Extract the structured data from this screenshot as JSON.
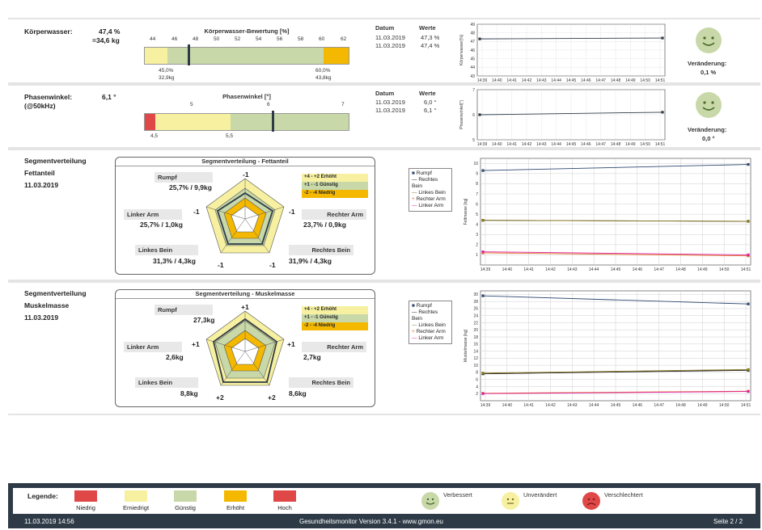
{
  "water": {
    "label": "Körperwasser:",
    "percent": "47,4 %",
    "kg": "=34,6 kg",
    "scale_title": "Körperwasser-Bewertung [%]",
    "ticks": [
      "44",
      "46",
      "48",
      "50",
      "52",
      "54",
      "56",
      "58",
      "60",
      "62"
    ],
    "low_pct": "45,0%",
    "low_kg": "32,9kg",
    "high_pct": "60,0%",
    "high_kg": "43,8kg",
    "col_date": "Datum",
    "col_values": "Werte",
    "rows": [
      {
        "date": "11.03.2019",
        "value": "47,3 %"
      },
      {
        "date": "11.03.2019",
        "value": "47,4 %"
      }
    ],
    "marker": 47.4,
    "change_label": "Veränderung:",
    "change_value": "0,1 %",
    "axis_label": "Körperwasser[%]",
    "yticks": [
      "49",
      "48",
      "47",
      "46",
      "45",
      "44",
      "43"
    ],
    "xticks": [
      "14:39",
      "14:40",
      "14:41",
      "14:42",
      "14:43",
      "14:44",
      "14:45",
      "14:46",
      "14:47",
      "14:48",
      "14:49",
      "14:50",
      "14:51"
    ]
  },
  "phase": {
    "label": "Phasenwinkel:",
    "label2": "(@50kHz)",
    "value": "6,1 °",
    "scale_title": "Phasenwinkel [°]",
    "ticks_top": [
      "5",
      "6",
      "7"
    ],
    "ticks_bottom": [
      "4,5",
      "5,5"
    ],
    "col_date": "Datum",
    "col_values": "Werte",
    "rows": [
      {
        "date": "11.03.2019",
        "value": "6,0 °"
      },
      {
        "date": "11.03.2019",
        "value": "6,1 °"
      }
    ],
    "marker": 6.05,
    "change_label": "Veränderung:",
    "change_value": "0,0 °",
    "axis_label": "Phasenwinkel[°]",
    "yticks": [
      "7",
      "6",
      "5"
    ],
    "xticks": [
      "14:39",
      "14:40",
      "14:41",
      "14:42",
      "14:43",
      "14:44",
      "14:45",
      "14:46",
      "14:47",
      "14:48",
      "14:49",
      "14:50",
      "14:51"
    ]
  },
  "fat": {
    "heading": "Segmentverteilung",
    "sub": "Fettanteil",
    "date": "11.03.2019",
    "box_title": "Segmentverteilung - Fettanteil",
    "rumpf_label": "Rumpf",
    "rumpf_val": "25,7% / 9,9kg",
    "la_label": "Linker Arm",
    "la_val": "25,7% / 1,0kg",
    "ra_label": "Rechter Arm",
    "ra_val": "23,7% / 0,9kg",
    "lb_label": "Linkes Bein",
    "lb_val": "31,3% / 4,3kg",
    "rb_label": "Rechtes Bein",
    "rb_val": "31,9% / 4,3kg",
    "v_top": "-1",
    "v_left": "-1",
    "v_right": "-1",
    "v_bl": "-1",
    "v_br": "-1",
    "leg1": "+4 - +2   Erhöht",
    "leg2": "+1 - -1   Günstig",
    "leg3": "-2 - -4   Niedrig",
    "axis_label": "Fettmasse [kg]",
    "yticks": [
      "10",
      "9",
      "8",
      "7",
      "6",
      "5",
      "4",
      "3",
      "2",
      "1"
    ],
    "xticks": [
      "14:39",
      "14:40",
      "14:41",
      "14:42",
      "14:43",
      "14:44",
      "14:45",
      "14:46",
      "14:47",
      "14:48",
      "14:49",
      "14:50",
      "14:51"
    ],
    "series_names": [
      "Rumpf",
      "Rechtes Bein",
      "Linkes Bein",
      "Rechter Arm",
      "Linker Arm"
    ]
  },
  "muscle": {
    "heading": "Segmentverteilung",
    "sub": "Muskelmasse",
    "date": "11.03.2019",
    "box_title": "Segmentverteilung - Muskelmasse",
    "rumpf_label": "Rumpf",
    "rumpf_val": "27,3kg",
    "la_label": "Linker Arm",
    "la_val": "2,6kg",
    "ra_label": "Rechter Arm",
    "ra_val": "2,7kg",
    "lb_label": "Linkes Bein",
    "lb_val": "8,8kg",
    "rb_label": "Rechtes Bein",
    "rb_val": "8,6kg",
    "v_top": "+1",
    "v_left": "+1",
    "v_right": "+1",
    "v_bl": "+2",
    "v_br": "+2",
    "leg1": "+4 - +2   Erhöht",
    "leg2": "+1 - -1   Günstig",
    "leg3": "-2 - -4   Niedrig",
    "axis_label": "Muskelmasse [kg]",
    "yticks": [
      "30",
      "28",
      "26",
      "24",
      "22",
      "20",
      "18",
      "16",
      "14",
      "12",
      "10",
      "8",
      "6",
      "4",
      "2"
    ],
    "xticks": [
      "14:39",
      "14:40",
      "14:41",
      "14:42",
      "14:43",
      "14:44",
      "14:45",
      "14:46",
      "14:47",
      "14:48",
      "14:49",
      "14:50",
      "14:51"
    ],
    "series_names": [
      "Rumpf",
      "Rechtes Bein",
      "Linkes Bein",
      "Rechter Arm",
      "Linker Arm"
    ]
  },
  "legend": {
    "title": "Legende:",
    "items": [
      "Niedrig",
      "Erniedrigt",
      "Günstig",
      "Erhöht",
      "Hoch"
    ],
    "colors": [
      "#e04848",
      "#f6f0a0",
      "#c8d8a8",
      "#f4b800",
      "#e04848"
    ],
    "status": [
      "Verbessert",
      "Unverändert",
      "Verschlechtert"
    ]
  },
  "footer": {
    "datetime": "11.03.2019 14:56",
    "center": "Gesundheitsmonitor Version 3.4.1 - www.gmon.eu",
    "page": "Seite 2 / 2"
  },
  "chart_data": [
    {
      "type": "line",
      "title": "",
      "ylabel": "Körperwasser[%]",
      "x": [
        "14:39",
        "14:51"
      ],
      "series": [
        {
          "values": [
            47.3,
            47.4
          ]
        }
      ],
      "ylim": [
        43,
        49
      ]
    },
    {
      "type": "line",
      "title": "",
      "ylabel": "Phasenwinkel[°]",
      "x": [
        "14:39",
        "14:51"
      ],
      "series": [
        {
          "values": [
            6.0,
            6.1
          ]
        }
      ],
      "ylim": [
        5,
        7
      ]
    },
    {
      "type": "line",
      "title": "",
      "ylabel": "Fettmasse [kg]",
      "x": [
        "14:39",
        "14:51"
      ],
      "ylim": [
        0,
        10.5
      ],
      "series": [
        {
          "name": "Rumpf",
          "values": [
            9.3,
            9.9
          ]
        },
        {
          "name": "Rechtes Bein",
          "values": [
            4.4,
            4.3
          ]
        },
        {
          "name": "Linkes Bein",
          "values": [
            4.4,
            4.3
          ]
        },
        {
          "name": "Rechter Arm",
          "values": [
            1.2,
            0.9
          ]
        },
        {
          "name": "Linker Arm",
          "values": [
            1.3,
            1.0
          ]
        }
      ]
    },
    {
      "type": "line",
      "title": "",
      "ylabel": "Muskelmasse [kg]",
      "x": [
        "14:39",
        "14:51"
      ],
      "ylim": [
        0,
        31
      ],
      "series": [
        {
          "name": "Rumpf",
          "values": [
            29.6,
            27.3
          ]
        },
        {
          "name": "Rechtes Bein",
          "values": [
            7.6,
            8.6
          ]
        },
        {
          "name": "Linkes Bein",
          "values": [
            7.8,
            8.8
          ]
        },
        {
          "name": "Rechter Arm",
          "values": [
            2.1,
            2.7
          ]
        },
        {
          "name": "Linker Arm",
          "values": [
            2.0,
            2.6
          ]
        }
      ]
    }
  ]
}
